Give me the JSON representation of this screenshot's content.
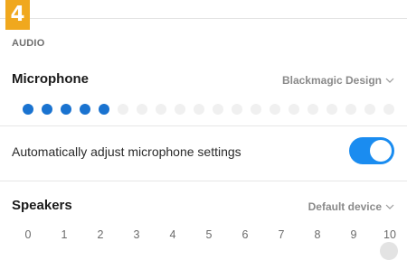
{
  "badge": "4",
  "section": {
    "label": "AUDIO"
  },
  "microphone": {
    "title": "Microphone",
    "device": "Blackmagic Design",
    "level": {
      "active": 5,
      "total": 20
    }
  },
  "auto_adjust": {
    "label": "Automatically adjust microphone settings",
    "enabled": true
  },
  "speakers": {
    "title": "Speakers",
    "device": "Default device",
    "scale": [
      "0",
      "1",
      "2",
      "3",
      "4",
      "5",
      "6",
      "7",
      "8",
      "9",
      "10"
    ]
  },
  "colors": {
    "accent": "#1a73d0",
    "toggle_on": "#1a8cf0",
    "badge": "#f0a81e"
  }
}
